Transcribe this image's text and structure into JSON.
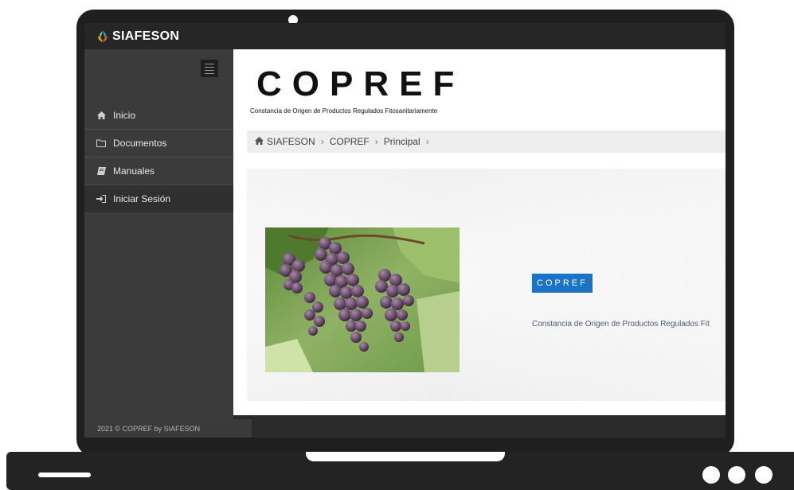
{
  "app": {
    "brand": "SIAFESON",
    "title": "COPREF",
    "subtitle": "Constancia de Origen de Productos Regulados Fitosanitariamente"
  },
  "sidebar": {
    "items": [
      {
        "label": "Inicio",
        "icon": "home-icon"
      },
      {
        "label": "Documentos",
        "icon": "folder-icon"
      },
      {
        "label": "Manuales",
        "icon": "book-icon"
      },
      {
        "label": "Iniciar Sesión",
        "icon": "sign-in-icon"
      }
    ]
  },
  "breadcrumb": {
    "items": [
      "SIAFESON",
      "COPREF",
      "Principal"
    ],
    "separator": "›"
  },
  "hero": {
    "badge": "COPREF",
    "description": "Constancia de Origen de Productos Regulados Fit",
    "image": "grapes-image"
  },
  "footer": {
    "text": "2021 © COPREF by SIAFESON"
  },
  "colors": {
    "accent": "#1a73c4",
    "sidebar": "#3b3b3b",
    "frame": "#1f1f1f"
  }
}
